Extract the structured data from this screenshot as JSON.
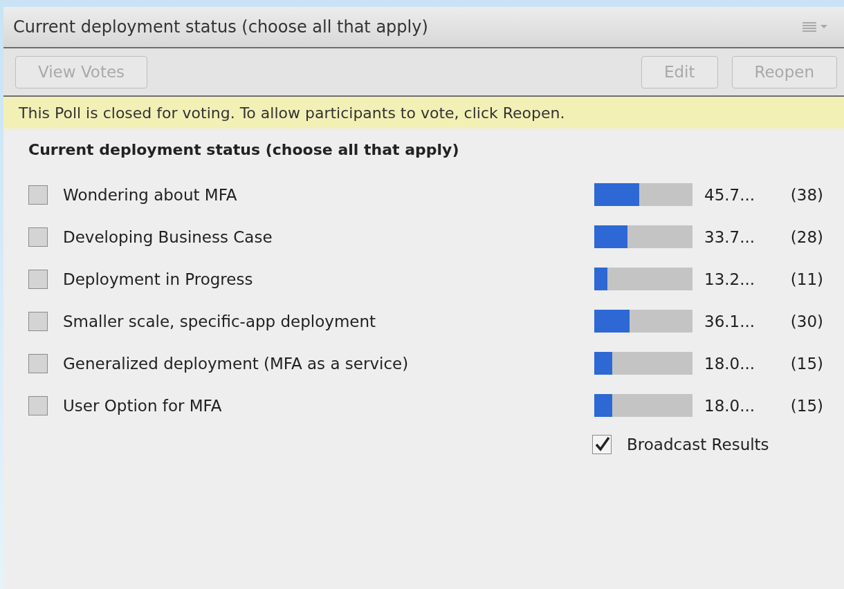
{
  "panel": {
    "title": "Current deployment status (choose all that apply)"
  },
  "toolbar": {
    "left_buttons": [
      {
        "label": "View Votes",
        "disabled": true
      }
    ],
    "right_buttons": [
      {
        "label": "Edit",
        "disabled": true
      },
      {
        "label": "Reopen",
        "disabled": true
      }
    ]
  },
  "notice": "This Poll is closed for voting. To allow participants to vote, click Reopen.",
  "question": "Current deployment status (choose all that apply)",
  "answers": [
    {
      "label": "Wondering about MFA",
      "checked": false,
      "level": 0.457,
      "percent": "45.7...",
      "count": "(38)"
    },
    {
      "label": "Developing Business Case",
      "checked": false,
      "level": 0.337,
      "percent": "33.7...",
      "count": "(28)"
    },
    {
      "label": "Deployment in Progress",
      "checked": false,
      "level": 0.132,
      "percent": "13.2...",
      "count": "(11)"
    },
    {
      "label": "Smaller scale, specific-app deployment",
      "checked": false,
      "level": 0.361,
      "percent": "36.1...",
      "count": "(30)"
    },
    {
      "label": "Generalized deployment (MFA as a service)",
      "checked": false,
      "level": 0.18,
      "percent": "18.0...",
      "count": "(15)"
    },
    {
      "label": "User Option for MFA",
      "checked": false,
      "level": 0.18,
      "percent": "18.0...",
      "count": "(15)"
    }
  ],
  "broadcast": {
    "label": "Broadcast Results",
    "checked": true
  }
}
